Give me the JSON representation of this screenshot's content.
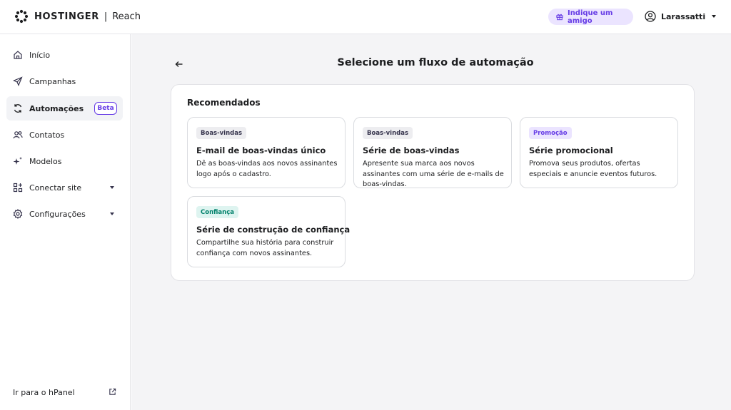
{
  "header": {
    "brand_name": "HOSTINGER",
    "separator": "|",
    "product": "Reach",
    "refer_label": "Indique um amigo",
    "user_name": "Larassatti"
  },
  "sidebar": {
    "items": [
      {
        "label": "Início",
        "icon": "home-icon"
      },
      {
        "label": "Campanhas",
        "icon": "send-icon"
      },
      {
        "label": "Automações",
        "icon": "refresh-icon",
        "badge": "Beta",
        "active": true
      },
      {
        "label": "Contatos",
        "icon": "users-icon"
      },
      {
        "label": "Modelos",
        "icon": "sparkle-icon"
      },
      {
        "label": "Conectar site",
        "icon": "apps-icon",
        "expandable": true
      },
      {
        "label": "Configurações",
        "icon": "gear-icon",
        "expandable": true
      }
    ],
    "footer_link": "Ir para o hPanel"
  },
  "main": {
    "title": "Selecione um fluxo de automação",
    "section_title": "Recomendados",
    "cards": [
      {
        "tag": "Boas-vindas",
        "tag_color": "gray",
        "title": "E-mail de boas-vindas único",
        "description": "Dê as boas-vindas aos novos assinantes logo após o cadastro."
      },
      {
        "tag": "Boas-vindas",
        "tag_color": "gray",
        "title": "Série de boas-vindas",
        "description": "Apresente sua marca aos novos assinantes com uma série de e-mails de boas-vindas."
      },
      {
        "tag": "Promoção",
        "tag_color": "purple",
        "title": "Série promocional",
        "description": "Promova seus produtos, ofertas especiais e anuncie eventos futuros."
      },
      {
        "tag": "Confiança",
        "tag_color": "green",
        "title": "Série de construção de confiança",
        "description": "Compartilhe sua história para construir confiança com novos assinantes."
      }
    ]
  },
  "colors": {
    "accent": "#673de6",
    "accent_light": "#ebe4ff",
    "success": "#00806a",
    "background": "#f4f4f6"
  }
}
